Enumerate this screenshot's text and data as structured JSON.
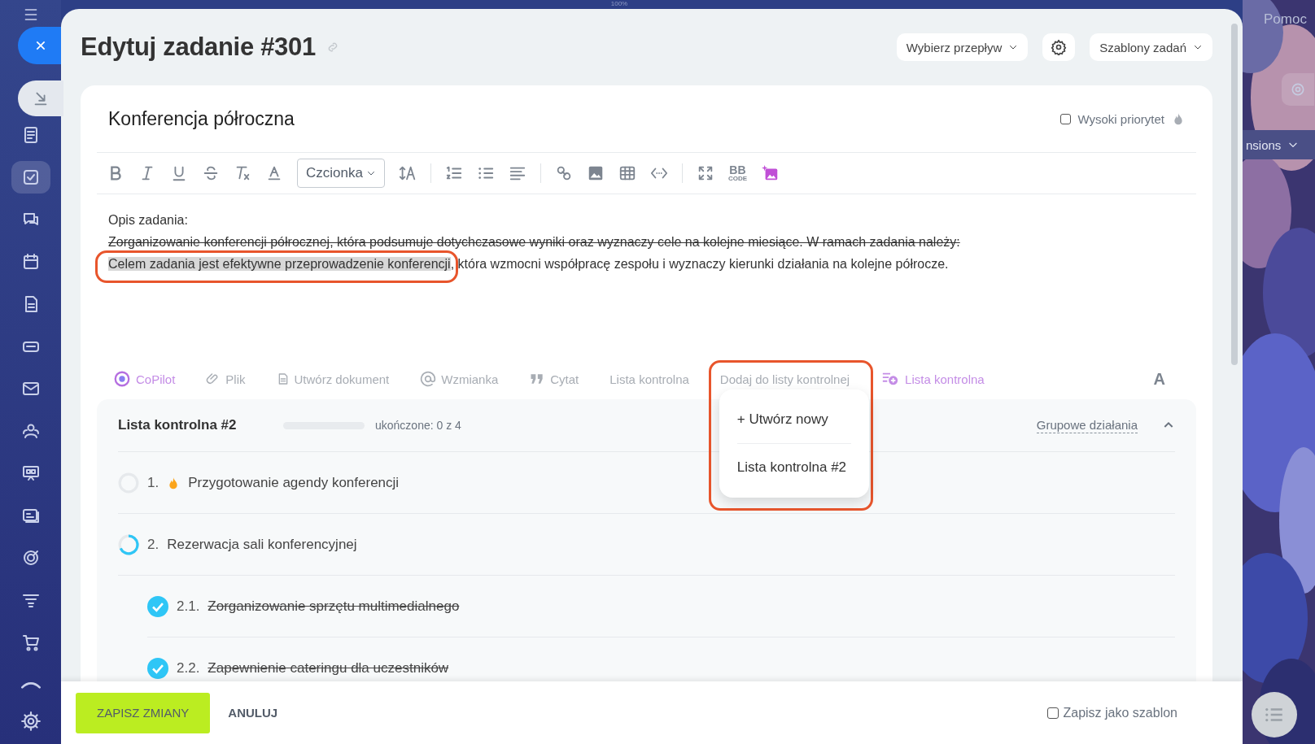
{
  "top_bar": {
    "zoom": "100%"
  },
  "sidebar": {
    "items": [
      {
        "selected": false
      },
      {
        "selected": true
      },
      {
        "selected": false
      },
      {
        "selected": false
      },
      {
        "selected": false
      },
      {
        "selected": false
      },
      {
        "selected": false
      },
      {
        "selected": false
      },
      {
        "selected": false
      },
      {
        "selected": false
      },
      {
        "selected": false
      },
      {
        "selected": false
      },
      {
        "selected": false
      },
      {
        "selected": false
      }
    ]
  },
  "right_strip": {
    "help": "Pomoc",
    "partial_label": "nsions"
  },
  "header": {
    "title": "Edytuj zadanie #301",
    "flow_button": "Wybierz przepływ",
    "templates_button": "Szablony zadań"
  },
  "task": {
    "title": "Konferencja półroczna",
    "priority": {
      "label": "Wysoki priorytet",
      "checked": false
    }
  },
  "toolbar": {
    "font_select": "Czcionka",
    "bbcode": {
      "top": "BB",
      "bottom": "CODE"
    }
  },
  "description": [
    {
      "text": "Opis zadania:",
      "strikethrough": false
    },
    {
      "text": "Zorganizowanie konferencji półrocznej, która podsumuje dotychczasowe wyniki oraz wyznaczy cele na kolejne miesiące. W ramach zadania należy:",
      "strikethrough": true
    },
    {
      "highlighted": "Celem zadania jest efektywne przeprowadzenie konferencji",
      "text": ", która wzmocni współpracę zespołu i wyznaczy kierunki działania na kolejne półrocze.",
      "strikethrough": false,
      "annotated": true
    }
  ],
  "actions": [
    {
      "kind": "copilot",
      "label": "CoPilot"
    },
    {
      "kind": "file",
      "label": "Plik"
    },
    {
      "kind": "document",
      "label": "Utwórz dokument"
    },
    {
      "kind": "mention",
      "label": "Wzmianka"
    },
    {
      "kind": "quote",
      "label": "Cytat"
    },
    {
      "kind": "plain",
      "label": "Lista kontrolna"
    },
    {
      "kind": "menu",
      "label": "Dodaj do listy kontrolnej",
      "annotated": true,
      "menu": [
        "+ Utwórz nowy",
        "Lista kontrolna #2"
      ]
    },
    {
      "kind": "ai-checklist",
      "label": "Lista kontrolna"
    }
  ],
  "format_button": "A",
  "checklist": {
    "title": "Lista kontrolna #2",
    "level": 0,
    "progress_text": "ukończone: 0 z 4",
    "group_actions": "Grupowe działania",
    "expanded": true,
    "items": [
      {
        "number": "1.",
        "text": "Przygotowanie agendy konferencji",
        "checked": false,
        "important": true
      },
      {
        "number": "2.",
        "text": "Rezerwacja sali konferencyjnej",
        "checked": false,
        "important": false,
        "children": [
          {
            "number": "2.1.",
            "text": "Zorganizowanie sprzętu multimedialnego",
            "checked": true,
            "important": false
          },
          {
            "number": "2.2.",
            "text": "Zapewnienie cateringu dla uczestników",
            "checked": true,
            "important": false
          }
        ]
      }
    ]
  },
  "footer": {
    "save": "ZAPISZ ZMIANY",
    "cancel": "ANULUJ",
    "template": {
      "label": "Zapisz jako szablon",
      "checked": false
    }
  }
}
